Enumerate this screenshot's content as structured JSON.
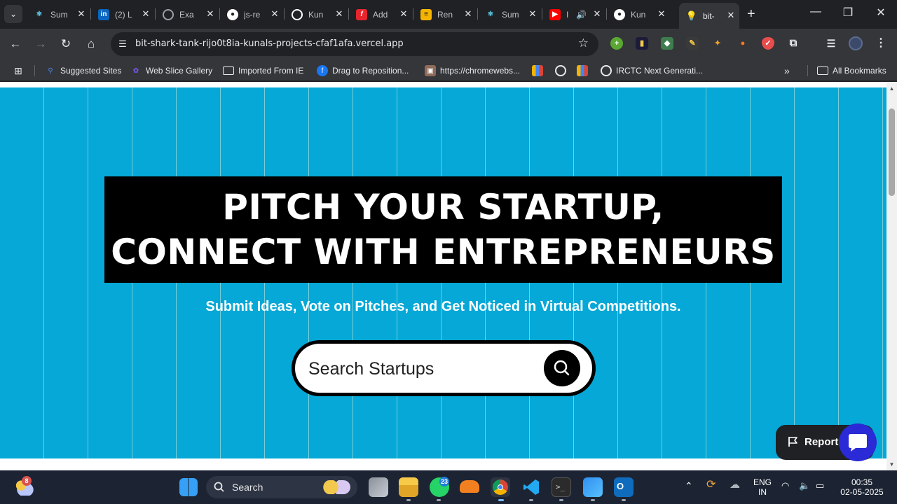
{
  "browser": {
    "tabs": [
      {
        "title": "Sum",
        "favicon": "react-icon",
        "color": "#61dafb"
      },
      {
        "title": "(2) L",
        "favicon": "linkedin-icon",
        "color": "#0a66c2"
      },
      {
        "title": "Exa",
        "favicon": "globe-icon",
        "color": "#9aa0a6"
      },
      {
        "title": "js-re",
        "favicon": "github-icon",
        "color": "#ffffff"
      },
      {
        "title": "Kun",
        "favicon": "openai-icon",
        "color": "#ffffff"
      },
      {
        "title": "Add",
        "favicon": "formulas-icon",
        "color": "#e8242d"
      },
      {
        "title": "Ren",
        "favicon": "stack-icon",
        "color": "#f4b400"
      },
      {
        "title": "Sum",
        "favicon": "react-icon",
        "color": "#61dafb"
      },
      {
        "title": "I",
        "favicon": "youtube-icon",
        "color": "#ff0000"
      },
      {
        "title": "Kun",
        "favicon": "github-icon",
        "color": "#ffffff"
      },
      {
        "title": "bit-",
        "favicon": "lightbulb-icon",
        "color": "#f5d36b",
        "active": true
      }
    ],
    "url": "bit-shark-tank-rijo0t8ia-kunals-projects-cfaf1afa.vercel.app",
    "bookmarks": [
      {
        "label": "Suggested Sites",
        "icon": "search-icon"
      },
      {
        "label": "Web Slice Gallery",
        "icon": "web-slice-icon"
      },
      {
        "label": "Imported From IE",
        "icon": "folder-icon"
      },
      {
        "label": "Drag to Reposition...",
        "icon": "facebook-icon"
      },
      {
        "label": "https://chromewebs...",
        "icon": "image-icon"
      },
      {
        "label": "IRCTC Next Generati...",
        "icon": "globe-icon"
      }
    ],
    "all_bookmarks": "All Bookmarks"
  },
  "page": {
    "headline_line1": "PITCH YOUR STARTUP,",
    "headline_line2": "CONNECT WITH ENTREPRENEURS",
    "subtitle": "Submit Ideas, Vote on Pitches, and Get Noticed in Virtual Competitions.",
    "search_placeholder": "Search Startups",
    "report_label": "Report a",
    "colors": {
      "hero_bg": "#05a8d6",
      "headline_bg": "#000000",
      "chat_button": "#2a2ad6"
    }
  },
  "taskbar": {
    "weather_badge": "8",
    "search_label": "Search",
    "whatsapp_badge": "23",
    "language_top": "ENG",
    "language_bottom": "IN",
    "time": "00:35",
    "date": "02-05-2025"
  }
}
